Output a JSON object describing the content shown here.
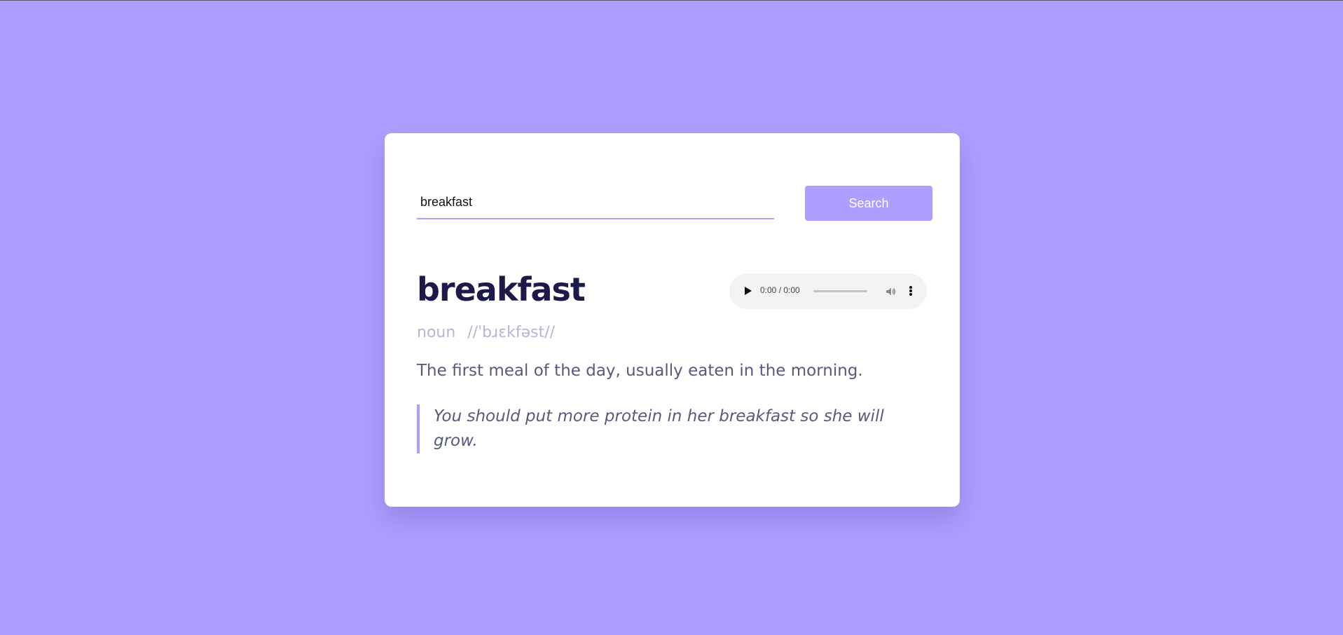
{
  "search": {
    "value": "breakfast",
    "button_label": "Search"
  },
  "entry": {
    "word": "breakfast",
    "part_of_speech": "noun",
    "phonetic": "//ˈbɹɛkfəst//",
    "definition": "The first meal of the day, usually eaten in the morning.",
    "example": "You should put more protein in her breakfast so she will grow."
  },
  "audio": {
    "time": "0:00 / 0:00",
    "icons": [
      "play-icon",
      "volume-icon",
      "more-options-icon"
    ]
  },
  "colors": {
    "background": "#ae9eff",
    "accent": "#ae9eff",
    "word": "#1d1a4a",
    "text": "#575a7b",
    "phonetic": "#b9b2d8"
  }
}
